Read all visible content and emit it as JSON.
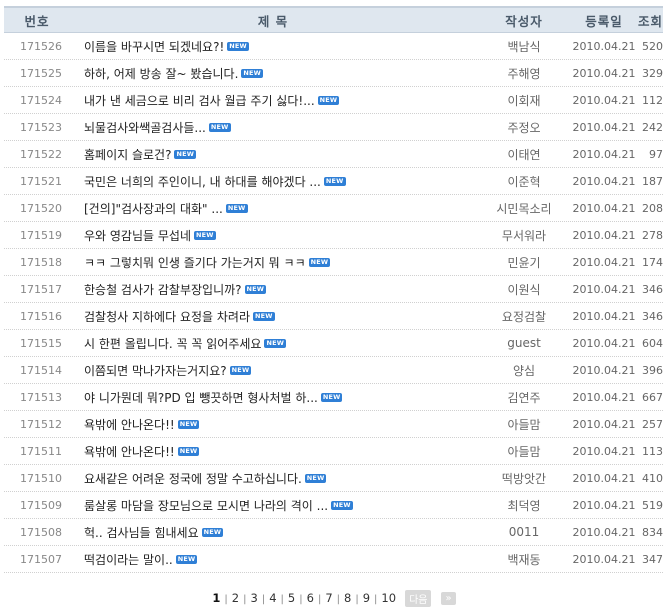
{
  "header": {
    "num": "번호",
    "title": "제 목",
    "author": "작성자",
    "date": "등록일",
    "views": "조회"
  },
  "new_label": "NEW",
  "rows": [
    {
      "num": "171526",
      "title": "이름을 바꾸시면 되겠네요?!",
      "author": "백남식",
      "date": "2010.04.21",
      "views": "520"
    },
    {
      "num": "171525",
      "title": "하하, 어제 방송 잘~ 봤습니다.",
      "author": "주해영",
      "date": "2010.04.21",
      "views": "329"
    },
    {
      "num": "171524",
      "title": "내가 낸 세금으로 비리 검사 월급 주기 싫다!...",
      "author": "이회재",
      "date": "2010.04.21",
      "views": "112"
    },
    {
      "num": "171523",
      "title": "뇌물검사와쌕골검사들...",
      "author": "주정오",
      "date": "2010.04.21",
      "views": "242"
    },
    {
      "num": "171522",
      "title": "홈페이지 슬로건?",
      "author": "이태연",
      "date": "2010.04.21",
      "views": "97"
    },
    {
      "num": "171521",
      "title": "국민은 너희의 주인이니, 내 하대를 해야겠다 ...",
      "author": "이준혁",
      "date": "2010.04.21",
      "views": "187"
    },
    {
      "num": "171520",
      "title": "[건의]\"검사장과의 대화\" ...",
      "author": "시민목소리",
      "date": "2010.04.21",
      "views": "208"
    },
    {
      "num": "171519",
      "title": "우와 영감님들 무섭네",
      "author": "무서워라",
      "date": "2010.04.21",
      "views": "278"
    },
    {
      "num": "171518",
      "title": "ㅋㅋ 그렇치뭐 인생 즐기다 가는거지 뭐 ㅋㅋ",
      "author": "민윤기",
      "date": "2010.04.21",
      "views": "174"
    },
    {
      "num": "171517",
      "title": "한승철 검사가 감찰부장입니까?",
      "author": "이원식",
      "date": "2010.04.21",
      "views": "346"
    },
    {
      "num": "171516",
      "title": "검찰청사 지하에다 요정을 차려라",
      "author": "요정검찰",
      "date": "2010.04.21",
      "views": "346"
    },
    {
      "num": "171515",
      "title": "시 한편 올립니다. 꼭 꼭 읽어주세요",
      "author": "guest",
      "date": "2010.04.21",
      "views": "604"
    },
    {
      "num": "171514",
      "title": "이쯤되면 막나가자는거지요?",
      "author": "양심",
      "date": "2010.04.21",
      "views": "396"
    },
    {
      "num": "171513",
      "title": "야 니가뭔데 뭐?PD 입 뺑끗하면 형사처벌 하...",
      "author": "김연주",
      "date": "2010.04.21",
      "views": "667"
    },
    {
      "num": "171512",
      "title": "욕밖에 안나온다!!",
      "author": "아들맘",
      "date": "2010.04.21",
      "views": "257"
    },
    {
      "num": "171511",
      "title": "욕밖에 안나온다!!",
      "author": "아들맘",
      "date": "2010.04.21",
      "views": "113"
    },
    {
      "num": "171510",
      "title": "요새같은 어려운 정국에 정말 수고하십니다.",
      "author": "떡방앗간",
      "date": "2010.04.21",
      "views": "410"
    },
    {
      "num": "171509",
      "title": "룸살롱 마담을 장모님으로 모시면 나라의 격이 ...",
      "author": "최덕영",
      "date": "2010.04.21",
      "views": "519"
    },
    {
      "num": "171508",
      "title": "헉.. 검사님들 힘내세요",
      "author": "0011",
      "date": "2010.04.21",
      "views": "834"
    },
    {
      "num": "171507",
      "title": "떡검이라는 말이..",
      "author": "백재동",
      "date": "2010.04.21",
      "views": "347"
    }
  ],
  "pagination": {
    "pages": [
      "1",
      "2",
      "3",
      "4",
      "5",
      "6",
      "7",
      "8",
      "9",
      "10"
    ],
    "current": "1",
    "next_label": "다음",
    "last_label": "»"
  },
  "colors": {
    "header_bg": "#dfe7ef",
    "new_badge": "#2f7fd6"
  }
}
